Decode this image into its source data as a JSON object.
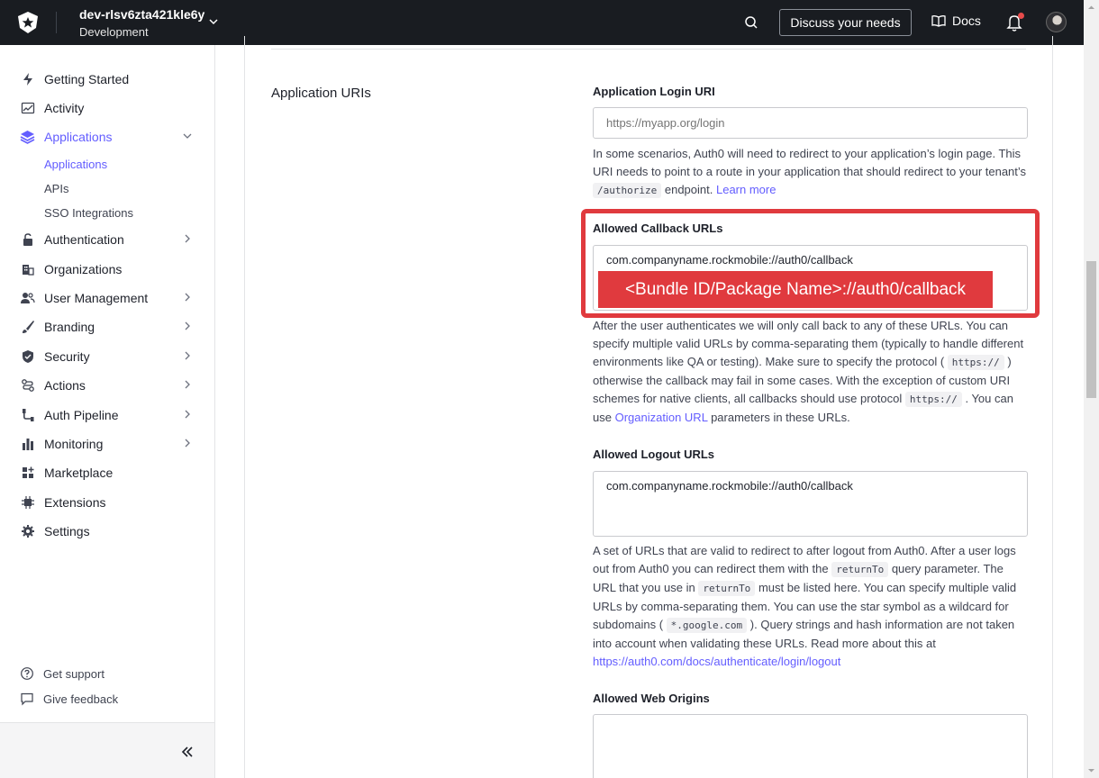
{
  "topbar": {
    "tenant_name": "dev-rlsv6zta421kle6y",
    "tenant_env": "Development",
    "discuss_label": "Discuss your needs",
    "docs_label": "Docs"
  },
  "sidebar": {
    "items": [
      {
        "label": "Getting Started",
        "icon": "bolt-icon"
      },
      {
        "label": "Activity",
        "icon": "activity-icon"
      },
      {
        "label": "Applications",
        "icon": "layers-icon"
      },
      {
        "label": "Authentication",
        "icon": "lock-icon"
      },
      {
        "label": "Organizations",
        "icon": "building-icon"
      },
      {
        "label": "User Management",
        "icon": "users-icon"
      },
      {
        "label": "Branding",
        "icon": "brush-icon"
      },
      {
        "label": "Security",
        "icon": "shield-icon"
      },
      {
        "label": "Actions",
        "icon": "actions-icon"
      },
      {
        "label": "Auth Pipeline",
        "icon": "pipeline-icon"
      },
      {
        "label": "Monitoring",
        "icon": "bar-chart-icon"
      },
      {
        "label": "Marketplace",
        "icon": "marketplace-icon"
      },
      {
        "label": "Extensions",
        "icon": "chip-icon"
      },
      {
        "label": "Settings",
        "icon": "gear-icon"
      }
    ],
    "sub_items": [
      {
        "label": "Applications"
      },
      {
        "label": "APIs"
      },
      {
        "label": "SSO Integrations"
      }
    ],
    "footer": {
      "support": "Get support",
      "feedback": "Give feedback"
    }
  },
  "main": {
    "section_title": "Application URIs",
    "login_uri": {
      "label": "Application Login URI",
      "placeholder": "https://myapp.org/login",
      "help_1": "In some scenarios, Auth0 will need to redirect to your application’s login page. This URI needs to point to a route in your application that should redirect to your tenant’s",
      "help_code": "/authorize",
      "help_2": "endpoint.",
      "help_link": "Learn more"
    },
    "callback": {
      "label": "Allowed Callback URLs",
      "value": "com.companyname.rockmobile://auth0/callback",
      "annotation": "<Bundle ID/Package Name>://auth0/callback",
      "help_1": "After the user authenticates we will only call back to any of these URLs. You can specify multiple valid URLs by comma-separating them (typically to handle different environments like QA or testing). Make sure to specify the protocol (",
      "help_code_1": "https://",
      "help_2": ") otherwise the callback may fail in some cases. With the exception of custom URI schemes for native clients, all callbacks should use protocol",
      "help_code_2": "https://",
      "help_3": ". You can use",
      "help_link": "Organization URL",
      "help_4": "parameters in these URLs."
    },
    "logout": {
      "label": "Allowed Logout URLs",
      "value": "com.companyname.rockmobile://auth0/callback",
      "help_1": "A set of URLs that are valid to redirect to after logout from Auth0. After a user logs out from Auth0 you can redirect them with the",
      "help_code_1": "returnTo",
      "help_2": "query parameter. The URL that you use in",
      "help_code_2": "returnTo",
      "help_3": "must be listed here. You can specify multiple valid URLs by comma-separating them. You can use the star symbol as a wildcard for subdomains (",
      "help_code_3": "*.google.com",
      "help_4": "). Query strings and hash information are not taken into account when validating these URLs. Read more about this at",
      "help_link": "https://auth0.com/docs/authenticate/login/logout"
    },
    "web_origins": {
      "label": "Allowed Web Origins",
      "value": ""
    }
  },
  "colors": {
    "accent": "#635dff",
    "topbar": "#191c21",
    "highlight": "#e03a3e"
  }
}
